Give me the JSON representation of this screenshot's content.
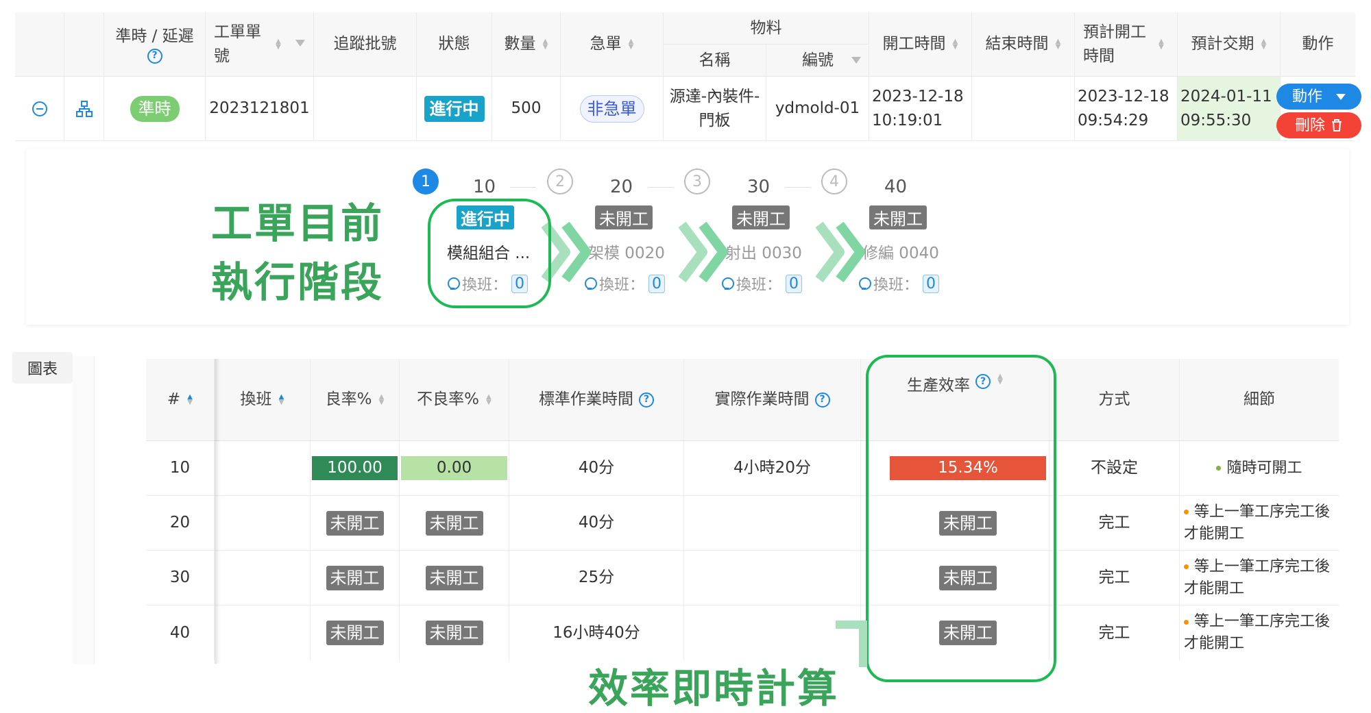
{
  "top_table": {
    "headers": {
      "on_time": "準時 / 延遲",
      "order_no": "工單單號",
      "trace": "追蹤批號",
      "status": "狀態",
      "qty": "數量",
      "urgent": "急單",
      "material": "物料",
      "mat_name": "名稱",
      "mat_code": "編號",
      "start_time": "開工時間",
      "end_time": "結束時間",
      "plan_start": "預計開工時間",
      "plan_due": "預計交期",
      "action": "動作"
    },
    "row": {
      "on_time": "準時",
      "order_no": "2023121801",
      "trace": "",
      "status": "進行中",
      "qty": "500",
      "urgent": "非急單",
      "mat_name": "源達-內裝件-門板",
      "mat_code": "ydmold-01",
      "start_time": "2023-12-18 10:19:01",
      "end_time": "",
      "plan_start": "2023-12-18 09:54:29",
      "plan_due": "2024-01-11 09:55:30"
    },
    "buttons": {
      "action": "動作",
      "delete": "刪除"
    }
  },
  "stage_panel": {
    "note_line1": "工單目前",
    "note_line2": "執行階段",
    "steps": [
      {
        "index": "1",
        "seq": "10",
        "status": "進行中",
        "name": "模組組合 ...",
        "shift_label": "換班：",
        "shift_count": "0"
      },
      {
        "index": "2",
        "seq": "20",
        "status": "未開工",
        "name": "架模 0020",
        "shift_label": "換班：",
        "shift_count": "0"
      },
      {
        "index": "3",
        "seq": "30",
        "status": "未開工",
        "name": "射出 0030",
        "shift_label": "換班：",
        "shift_count": "0"
      },
      {
        "index": "4",
        "seq": "40",
        "status": "未開工",
        "name": "修編 0040",
        "shift_label": "換班：",
        "shift_count": "0"
      }
    ]
  },
  "tabs": {
    "chart": "圖表"
  },
  "process_table": {
    "headers": {
      "seq": "#",
      "shift": "換班",
      "yield": "良率%",
      "defect": "不良率%",
      "std_time": "標準作業時間",
      "act_time": "實際作業時間",
      "efficiency": "生產效率",
      "method": "方式",
      "detail": "細節"
    },
    "rows": [
      {
        "seq": "10",
        "yield": "100.00",
        "defect": "0.00",
        "std_time": "40分",
        "act_time": "4小時20分",
        "efficiency": "15.34%",
        "method": "不設定",
        "detail": "隨時可開工",
        "dot": "#7cb342"
      },
      {
        "seq": "20",
        "yield": "未開工",
        "defect": "未開工",
        "std_time": "40分",
        "act_time": "",
        "efficiency": "未開工",
        "method": "完工",
        "detail": "等上一筆工序完工後才能開工",
        "dot": "#ff8f00"
      },
      {
        "seq": "30",
        "yield": "未開工",
        "defect": "未開工",
        "std_time": "25分",
        "act_time": "",
        "efficiency": "未開工",
        "method": "完工",
        "detail": "等上一筆工序完工後才能開工",
        "dot": "#ff8f00"
      },
      {
        "seq": "40",
        "yield": "未開工",
        "defect": "未開工",
        "std_time": "16小時40分",
        "act_time": "",
        "efficiency": "未開工",
        "method": "完工",
        "detail": "等上一筆工序完工後才能開工",
        "dot": "#ff8f00"
      }
    ]
  },
  "efficiency_note": "效率即時計算",
  "colors": {
    "accent_blue": "#1e88e5",
    "highlight_green": "#1db954",
    "note_green": "#3aa45b",
    "yield_dark": "#2f8a57",
    "yield_light": "#b6e2a6",
    "efficiency_red": "#e6553a",
    "delete_red": "#f44336"
  }
}
